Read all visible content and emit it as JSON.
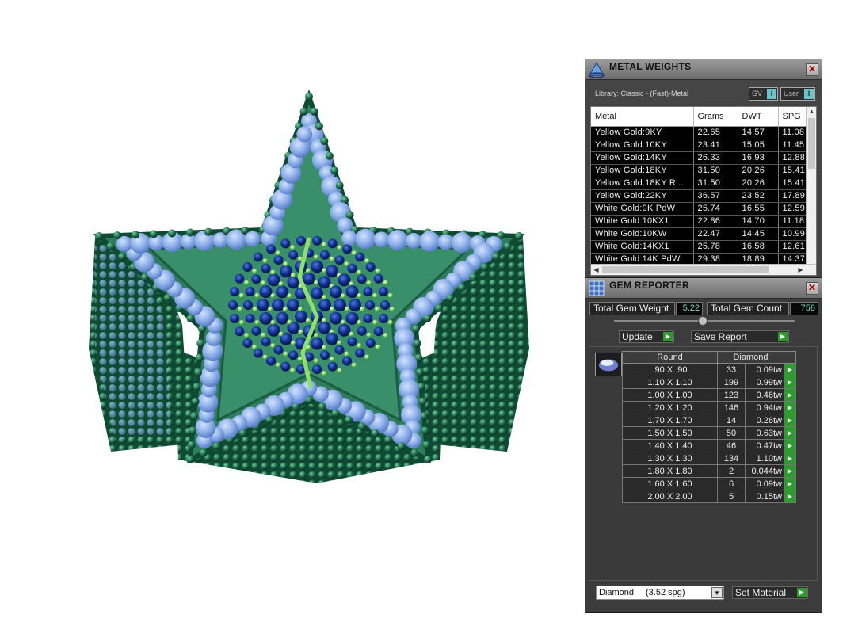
{
  "metal_weights": {
    "title": "METAL WEIGHTS",
    "library": "Library: Classic - (Fast)-Metal",
    "toggles": [
      {
        "label": "GV",
        "marker": "I"
      },
      {
        "label": "User",
        "marker": "I"
      }
    ],
    "columns": [
      "Metal",
      "Grams",
      "DWT",
      "SPG"
    ],
    "rows": [
      [
        "Yellow Gold:9KY",
        "22.65",
        "14.57",
        "11.08"
      ],
      [
        "Yellow Gold:10KY",
        "23.41",
        "15.05",
        "11.45"
      ],
      [
        "Yellow Gold:14KY",
        "26.33",
        "16.93",
        "12.88"
      ],
      [
        "Yellow Gold:18KY",
        "31.50",
        "20.26",
        "15.41"
      ],
      [
        "Yellow Gold:18KY R...",
        "31.50",
        "20.26",
        "15.41"
      ],
      [
        "Yellow Gold:22KY",
        "36.57",
        "23.52",
        "17.89"
      ],
      [
        "White Gold:9K PdW",
        "25.74",
        "16.55",
        "12.59"
      ],
      [
        "White Gold:10KX1",
        "22.86",
        "14.70",
        "11.18"
      ],
      [
        "White Gold:10KW",
        "22.47",
        "14.45",
        "10.99"
      ],
      [
        "White Gold:14KX1",
        "25.78",
        "16.58",
        "12.61"
      ],
      [
        "White Gold:14K PdW",
        "29.38",
        "18.89",
        "14.37"
      ]
    ]
  },
  "gem_reporter": {
    "title": "GEM REPORTER",
    "total_weight_label": "Total Gem Weight",
    "total_weight_value": "5.22",
    "total_count_label": "Total Gem Count",
    "total_count_value": "758",
    "update_label": "Update",
    "save_report_label": "Save Report",
    "table_header_shape": "Round",
    "table_header_material": "Diamond",
    "rows": [
      {
        "size": ".90 X .90",
        "count": "33",
        "weight": "0.09tw"
      },
      {
        "size": "1.10 X 1.10",
        "count": "199",
        "weight": "0.99tw"
      },
      {
        "size": "1.00 X 1.00",
        "count": "123",
        "weight": "0.46tw"
      },
      {
        "size": "1.20 X 1.20",
        "count": "146",
        "weight": "0.94tw"
      },
      {
        "size": "1.70 X 1.70",
        "count": "14",
        "weight": "0.26tw"
      },
      {
        "size": "1.50 X 1.50",
        "count": "50",
        "weight": "0.63tw"
      },
      {
        "size": "1.40 X 1.40",
        "count": "46",
        "weight": "0.47tw"
      },
      {
        "size": "1.30 X 1.30",
        "count": "134",
        "weight": "1.10tw"
      },
      {
        "size": "1.80 X 1.80",
        "count": "2",
        "weight": "0.044tw"
      },
      {
        "size": "1.60 X 1.60",
        "count": "6",
        "weight": "0.09tw"
      },
      {
        "size": "2.00 X 2.00",
        "count": "5",
        "weight": "0.15tw"
      }
    ],
    "material_select": {
      "name": "Diamond",
      "spg": "(3.52 spg)"
    },
    "set_material_label": "Set Material"
  },
  "colors": {
    "metal_green": "#1f6b4c",
    "gem_light_blue": "#8fb2ea",
    "gem_dark_blue": "#0d2b8a",
    "accent_lime": "#8fe06a",
    "go_green": "#2f9a2f"
  }
}
